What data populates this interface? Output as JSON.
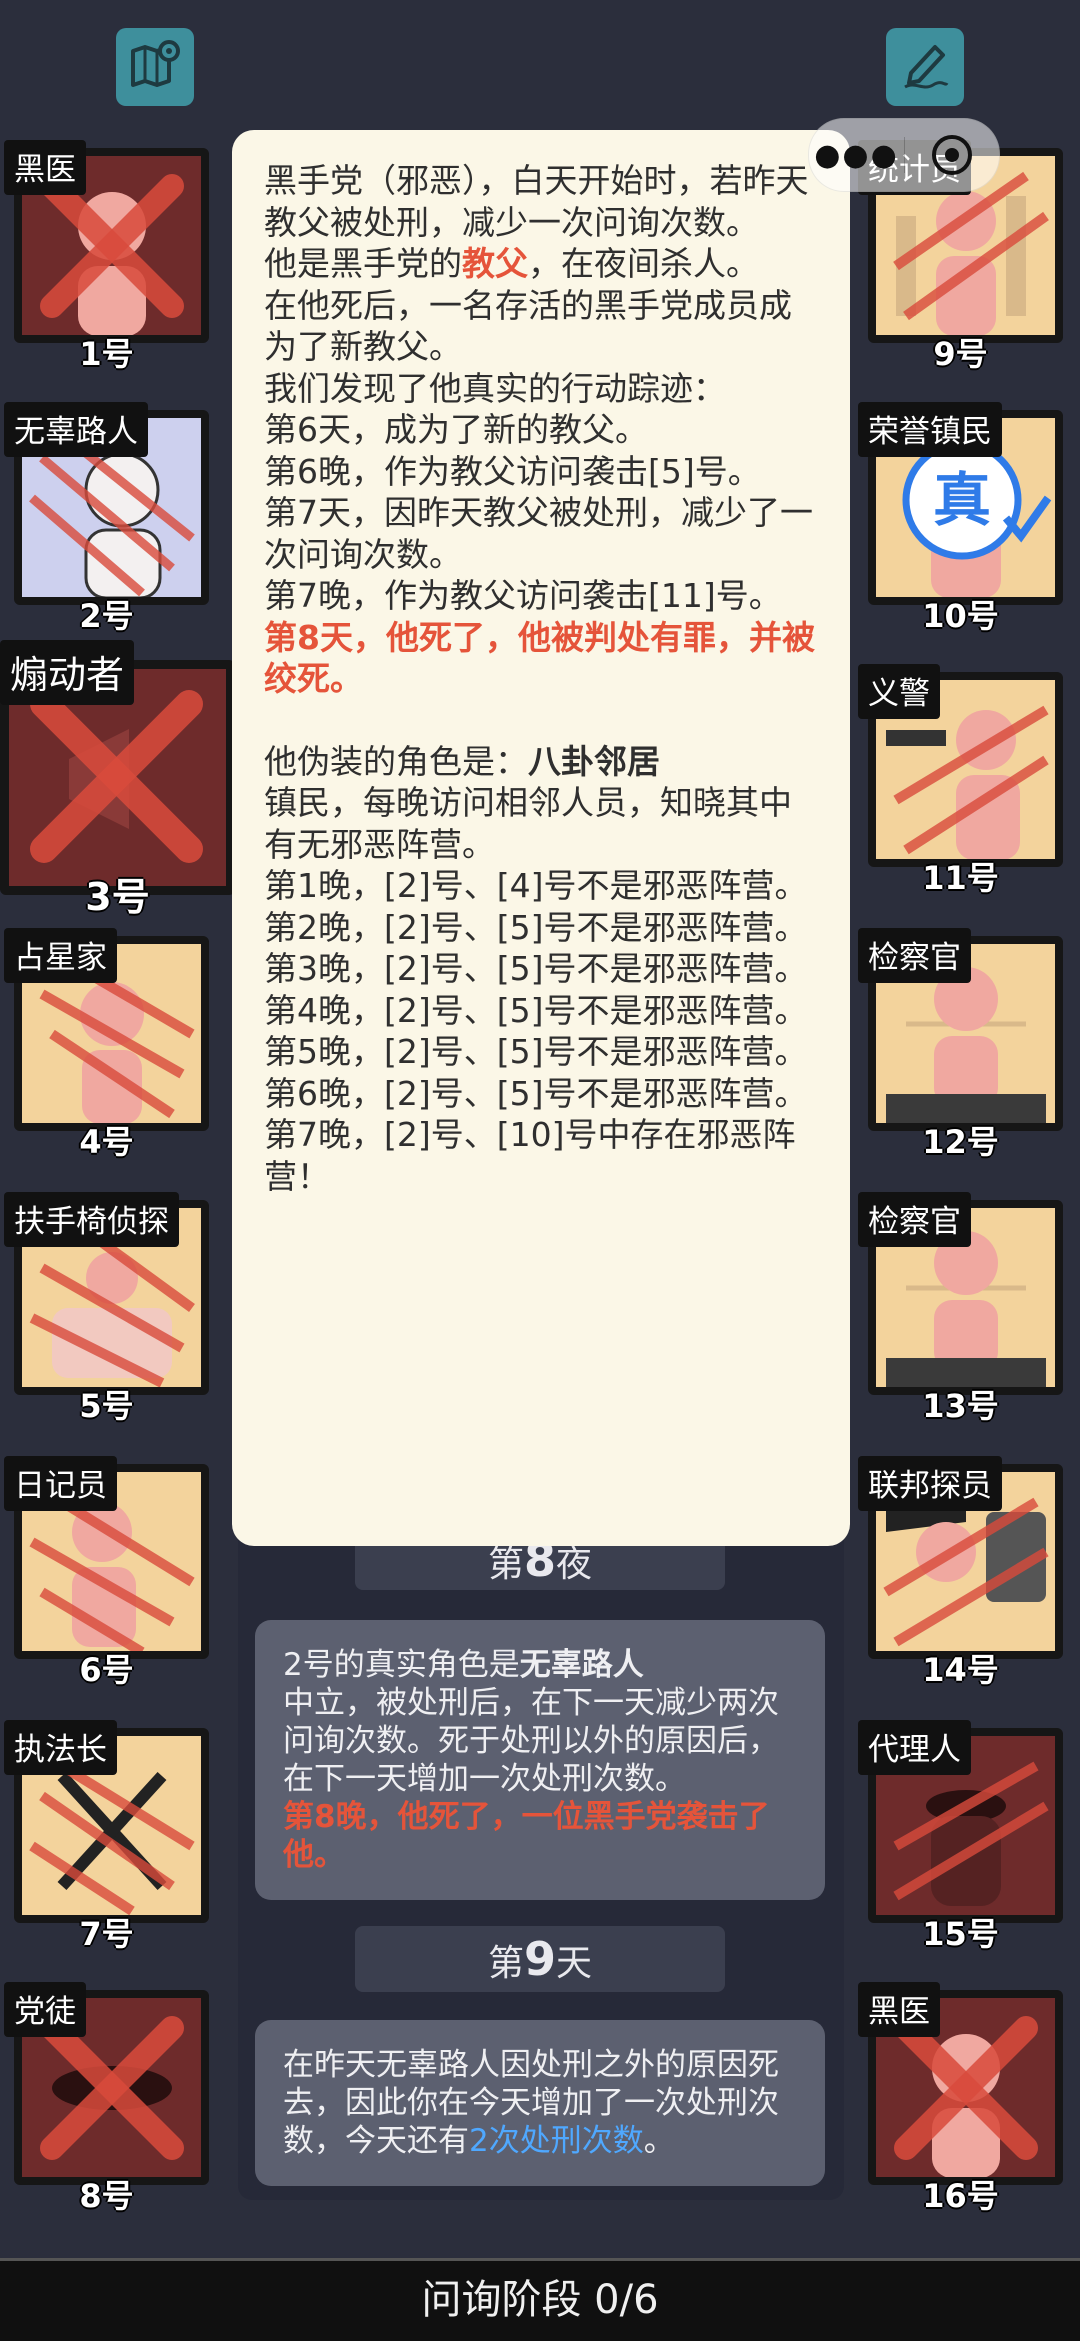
{
  "toolbar": {
    "map_icon": "map-pin-icon",
    "edit_icon": "pencil-signature-icon"
  },
  "players_left": [
    {
      "num": "1号",
      "role": "黑医",
      "state": "dead-x"
    },
    {
      "num": "2号",
      "role": "无辜路人",
      "state": "scratched"
    },
    {
      "num": "3号",
      "role": "煽动者",
      "state": "dead-x"
    },
    {
      "num": "4号",
      "role": "占星家",
      "state": "scratched"
    },
    {
      "num": "5号",
      "role": "扶手椅侦探",
      "state": "scratched"
    },
    {
      "num": "6号",
      "role": "日记员",
      "state": "scratched"
    },
    {
      "num": "7号",
      "role": "执法长",
      "state": "scratched"
    },
    {
      "num": "8号",
      "role": "党徒",
      "state": "dead-x"
    }
  ],
  "players_right": [
    {
      "num": "9号",
      "role": "统计员",
      "state": "scratched"
    },
    {
      "num": "10号",
      "role": "荣誉镇民",
      "state": "verified",
      "badge": "真"
    },
    {
      "num": "11号",
      "role": "义警",
      "state": "scratched"
    },
    {
      "num": "12号",
      "role": "检察官",
      "state": "alive"
    },
    {
      "num": "13号",
      "role": "检察官",
      "state": "alive"
    },
    {
      "num": "14号",
      "role": "联邦探员",
      "state": "scratched"
    },
    {
      "num": "15号",
      "role": "代理人",
      "state": "scratched"
    },
    {
      "num": "16号",
      "role": "黑医",
      "state": "dead-x"
    }
  ],
  "popup": {
    "intro": "黑手党（邪恶），白天开始时，若昨天教父被处刑，减少一次问询次数。",
    "role_line_pre": "他是黑手党的",
    "role_name": "教父",
    "role_line_post": "，在夜间杀人。",
    "succession": "在他死后，一名存活的黑手党成员成为了新教父。",
    "trace_header": "我们发现了他真实的行动踪迹：",
    "traces": [
      "第6天，成为了新的教父。",
      "第6晚，作为教父访问袭击[5]号。",
      "第7天，因昨天教父被处刑，减少了一次问询次数。",
      "第7晚，作为教父访问袭击[11]号。"
    ],
    "death": "第8天，他死了，他被判处有罪，并被绞死。",
    "disguise_pre": "他伪装的角色是：",
    "disguise_role": "八卦邻居",
    "disguise_desc": "镇民，每晚访问相邻人员，知晓其中有无邪恶阵营。",
    "claims": [
      "第1晚，[2]号、[4]号不是邪恶阵营。",
      "第2晚，[2]号、[5]号不是邪恶阵营。",
      "第3晚，[2]号、[5]号不是邪恶阵营。",
      "第4晚，[2]号、[5]号不是邪恶阵营。",
      "第5晚，[2]号、[5]号不是邪恶阵营。",
      "第6晚，[2]号、[5]号不是邪恶阵营。",
      "第7晚，[2]号、[10]号中存在邪恶阵营！"
    ]
  },
  "log": {
    "night_pre": "第",
    "night_num": "8",
    "night_post": "夜",
    "msg1_pre": "2号的真实角色是",
    "msg1_role": "无辜路人",
    "msg1_desc": "中立，被处刑后，在下一天减少两次问询次数。死于处刑以外的原因后，在下一天增加一次处刑次数。",
    "msg1_death": "第8晚，他死了，一位黑手党袭击了他。",
    "day_pre": "第",
    "day_num": "9",
    "day_post": "天",
    "msg2_text": "在昨天无辜路人因处刑之外的原因死去，因此你在今天增加了一次处刑次数，今天还有",
    "msg2_highlight": "2次处刑次数",
    "msg2_end": "。"
  },
  "bottom": {
    "phase": "问询阶段 0/6"
  }
}
